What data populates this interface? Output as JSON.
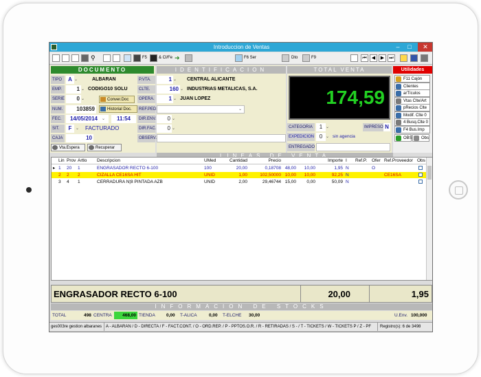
{
  "window": {
    "title": "Introduccion de Ventas"
  },
  "toolbar": {
    "f5": "F5",
    "clife": "& Cl/Fe",
    "f6": "F6 Ser",
    "dto": "Dto",
    "f9": "F9"
  },
  "documento": {
    "header": "DOCUMENTO",
    "tipo_label": "TIPO",
    "tipo_value": "A",
    "tipo_text": "ALBARAN",
    "emp_label": "EMP.",
    "emp_value": "1",
    "emp_text": "CODIGO10 SOLU",
    "serie_label": "SERIE",
    "serie_value": "0",
    "conver_btn": "Conver.Doc",
    "num_label": "NUM.",
    "num_value": "103859",
    "historial_btn": "Historial Doc.",
    "fec_label": "FEC.",
    "fec_value": "14/05/2014",
    "hora_value": "11:54",
    "sit_label": "SIT.",
    "sit_value": "F",
    "sit_text": "FACTURADO",
    "caja_label": "CAJA",
    "caja_value": "10",
    "vta_espera": "Vta.Espera",
    "recuperar": "Recuperar"
  },
  "identificacion": {
    "header": "IDENTIFICACION",
    "pvta_label": "P.VTA.",
    "pvta_value": "1",
    "pvta_text": "CENTRAL ALICANTE",
    "clte_label": "CLTE.",
    "clte_value": "160",
    "clte_text": "INDUSTRIAS METALICAS, S.A.",
    "opera_label": "OPERA.",
    "opera_value": "1",
    "opera_text": "JUAN LOPEZ",
    "refped_label": "REF.PED.",
    "direnv_label": "DIR.ENV.",
    "direnv_value": "0",
    "dirfac_label": "DIR.FAC.",
    "dirfac_value": "0",
    "observ_label": "OBSERV."
  },
  "total_venta": {
    "header": "TOTAL VENTA",
    "amount": "174,59",
    "categoria_label": "CATEGORIA",
    "categoria_value": "1",
    "impreso_label": "IMPRESO",
    "impreso_value": "N",
    "expedicion_label": "EXPEDICION",
    "expedicion_value": "0",
    "expedicion_text": "sin agencia",
    "entregado_label": "ENTREGADO"
  },
  "utilidades": {
    "header": "Utilidades",
    "items": [
      "F11 Cajón",
      "Clientes",
      "arTículos",
      "Vtas Clte/Art",
      "pRecios Clte",
      "Modif. Clte 0",
      "4 Busq.Clte 0",
      "F4 Bus.Imp",
      "OBS",
      "Obs"
    ]
  },
  "lineas": {
    "header": "LINEAS DE VENTA",
    "columns": [
      "Lin",
      "Prov",
      "Artlo",
      "Descripcion",
      "UMed",
      "Cantidad",
      "Precio",
      "",
      "",
      "Importe",
      "I",
      "Ref.P.",
      "Ofer",
      "Ref.Proveedor",
      "Obs"
    ],
    "rows": [
      {
        "lin": "1",
        "prov": "20",
        "art": "1",
        "desc": "ENGRASADOR RECTO 6-100",
        "umed": "100",
        "cant": "20,00",
        "precio": "0,18708",
        "d1": "48,00",
        "d2": "10,00",
        "imp": "1,95",
        "i": "N",
        "refp": "",
        "ofer": "O",
        "refprov": "",
        "obs": ""
      },
      {
        "lin": "2",
        "prov": "2",
        "art": "2",
        "desc": "CIZALLA CE16SA HIT",
        "umed": "UNID",
        "cant": "1,00",
        "precio": "102,50000",
        "d1": "10,00",
        "d2": "10,00",
        "imp": "92,25",
        "i": "N",
        "refp": "",
        "ofer": "",
        "refprov": "CE16SA",
        "obs": ""
      },
      {
        "lin": "3",
        "prov": "4",
        "art": "1",
        "desc": "CERRADURA N¦8 PINTADA AZB",
        "umed": "UNID",
        "cant": "2,00",
        "precio": "29,46744",
        "d1": "15,00",
        "d2": "0,00",
        "imp": "50,09",
        "i": "N",
        "refp": "",
        "ofer": "",
        "refprov": "",
        "obs": ""
      }
    ]
  },
  "selected": {
    "desc": "ENGRASADOR RECTO 6-100",
    "cant": "20,00",
    "imp": "1,95"
  },
  "stocks": {
    "header": "INFORMACION DE STOCKS",
    "total_label": "TOTAL",
    "total_value": "498",
    "centra_label": "CENTRA",
    "centra_value": "468,00",
    "tienda_label": "TIENDA",
    "tienda_value": "0,00",
    "talica_label": "T-ALICA",
    "talica_value": "0,00",
    "telche_label": "T-ELCHE",
    "telche_value": "30,00",
    "uenv_label": "U.Env.",
    "uenv_value": "100,000"
  },
  "status": {
    "left": "ges003re gestion albaranes",
    "middle": "A - ALBARAN / D - DIRECTA / F - FACT.CONT. / O - ORD.REP. / P - PPTOS.O.R. / R - RETIRADAS / S - / T - TICKETS / W - TICKETS P / Z - PF",
    "right": "Registro(s): 6 de 3498"
  },
  "colors": {
    "accent_green": "#2d8a2d",
    "total_green": "#22d022",
    "highlight_row": "#fff200",
    "red": "#e00000",
    "blue_text": "#1c1ca8"
  }
}
